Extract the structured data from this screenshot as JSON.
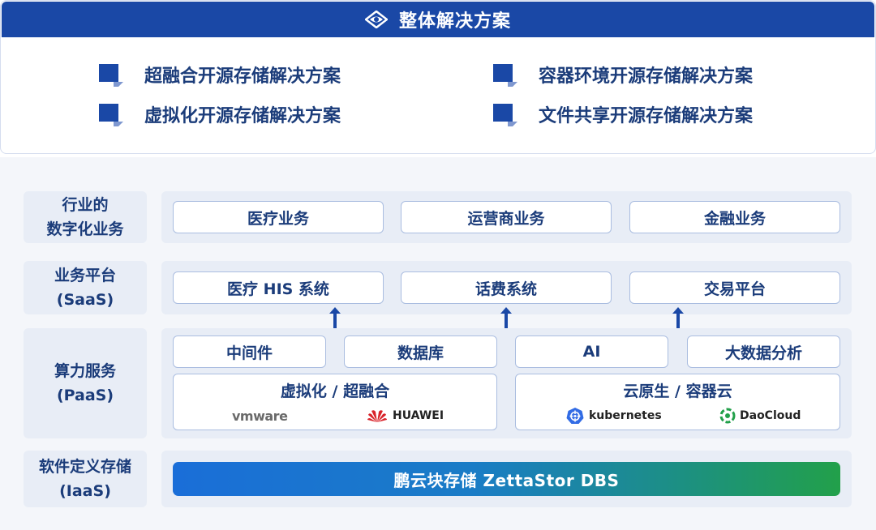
{
  "header": {
    "title": "整体解决方案",
    "icon": "diamond-eye-icon"
  },
  "solutions": [
    {
      "label": "超融合开源存储解决方案"
    },
    {
      "label": "容器环境开源存储解决方案"
    },
    {
      "label": "虚拟化开源存储解决方案"
    },
    {
      "label": "文件共享开源存储解决方案"
    }
  ],
  "layers": {
    "industry": {
      "label": "行业的\n数字化业务",
      "items": [
        "医疗业务",
        "运营商业务",
        "金融业务"
      ]
    },
    "saas": {
      "label": "业务平台\n(SaaS)",
      "items": [
        "医疗 HIS 系统",
        "话费系统",
        "交易平台"
      ]
    },
    "paas": {
      "label": "算力服务\n(PaaS)",
      "items": [
        "中间件",
        "数据库",
        "AI",
        "大数据分析"
      ],
      "groups": [
        {
          "title": "虚拟化 / 超融合",
          "logos": [
            "vmware",
            "HUAWEI"
          ]
        },
        {
          "title": "云原生 / 容器云",
          "logos": [
            "kubernetes",
            "DaoCloud"
          ]
        }
      ]
    },
    "iaas": {
      "label": "软件定义存储\n(IaaS)",
      "bar": "鹏云块存储  ZettaStor DBS"
    }
  },
  "colors": {
    "brand": "#1a48a6",
    "text": "#1b3c7a",
    "panel": "#e8edf6",
    "border": "#aabde0",
    "gradient_start": "#1a6ed8",
    "gradient_end": "#22a04a"
  }
}
